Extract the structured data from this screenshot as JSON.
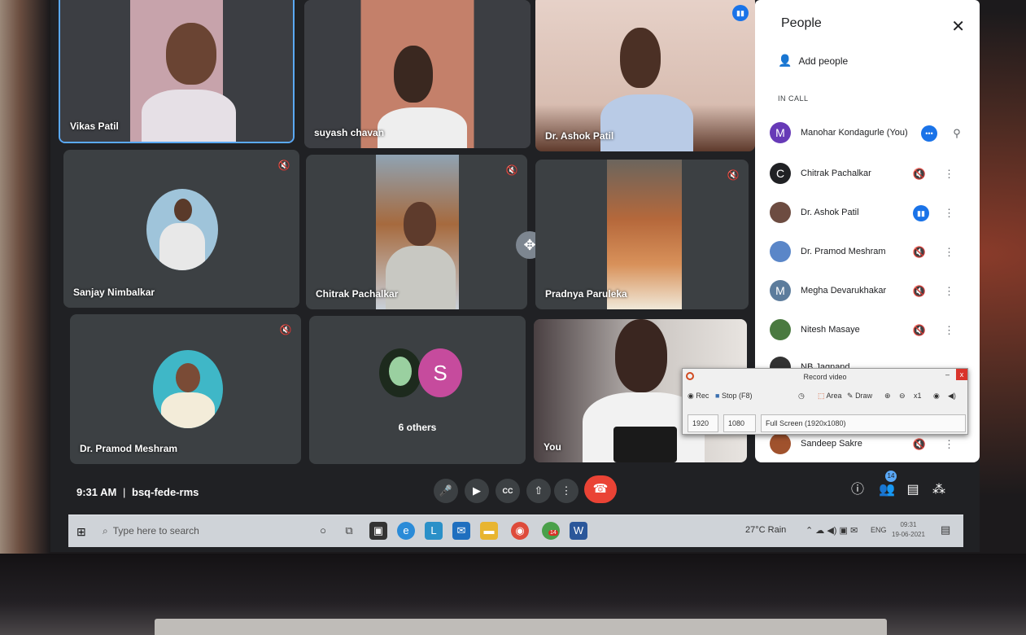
{
  "participants": [
    {
      "name": "Vikas Patil"
    },
    {
      "name": "suyash chavan"
    },
    {
      "name": "Dr. Ashok Patil"
    },
    {
      "name": "Sanjay Nimbalkar"
    },
    {
      "name": "Chitrak Pachalkar"
    },
    {
      "name": "Pradnya Paruleka"
    },
    {
      "name": "Dr. Pramod Meshram"
    },
    {
      "name": "6 others",
      "avatar_letter": "S"
    },
    {
      "name": "You"
    }
  ],
  "meeting": {
    "time": "9:31 AM",
    "separator": "|",
    "code": "bsq-fede-rms"
  },
  "controls": [
    "mic-icon",
    "camera-icon",
    "captions-icon",
    "present-icon",
    "more-icon",
    "end-call-icon"
  ],
  "right_controls": {
    "participant_count": "14"
  },
  "people_panel": {
    "title": "People",
    "add_people": "Add people",
    "section": "IN CALL",
    "people": [
      {
        "name": "Manohar Kondagurle (You)",
        "initial": "M",
        "color": "#673ab7"
      },
      {
        "name": "Chitrak Pachalkar",
        "initial": "C",
        "color": "#202124"
      },
      {
        "name": "Dr. Ashok Patil",
        "initial": "",
        "color": "#6d4c41"
      },
      {
        "name": "Dr. Pramod Meshram",
        "initial": "",
        "color": "#5a86c8"
      },
      {
        "name": "Megha Devarukhakar",
        "initial": "M",
        "color": "#5c7c9c"
      },
      {
        "name": "Nitesh Masaye",
        "initial": "",
        "color": "#4a7a40"
      },
      {
        "name": "NB Jagnand",
        "initial": "",
        "color": "#333333"
      },
      {
        "name": "Sandeep Sakre",
        "initial": "",
        "color": "#a0522d"
      }
    ]
  },
  "recorder": {
    "title": "Record video",
    "rec": "Rec",
    "stop": "Stop (F8)",
    "area": "Area",
    "draw": "Draw",
    "zoom": "x1",
    "width": "1920",
    "height": "1080",
    "mode": "Full Screen (1920x1080)",
    "min": "–",
    "close": "x"
  },
  "taskbar": {
    "search_placeholder": "Type here to search",
    "weather": "27°C Rain",
    "lang": "ENG",
    "time": "09:31",
    "date": "19-06-2021",
    "badge": "14"
  }
}
